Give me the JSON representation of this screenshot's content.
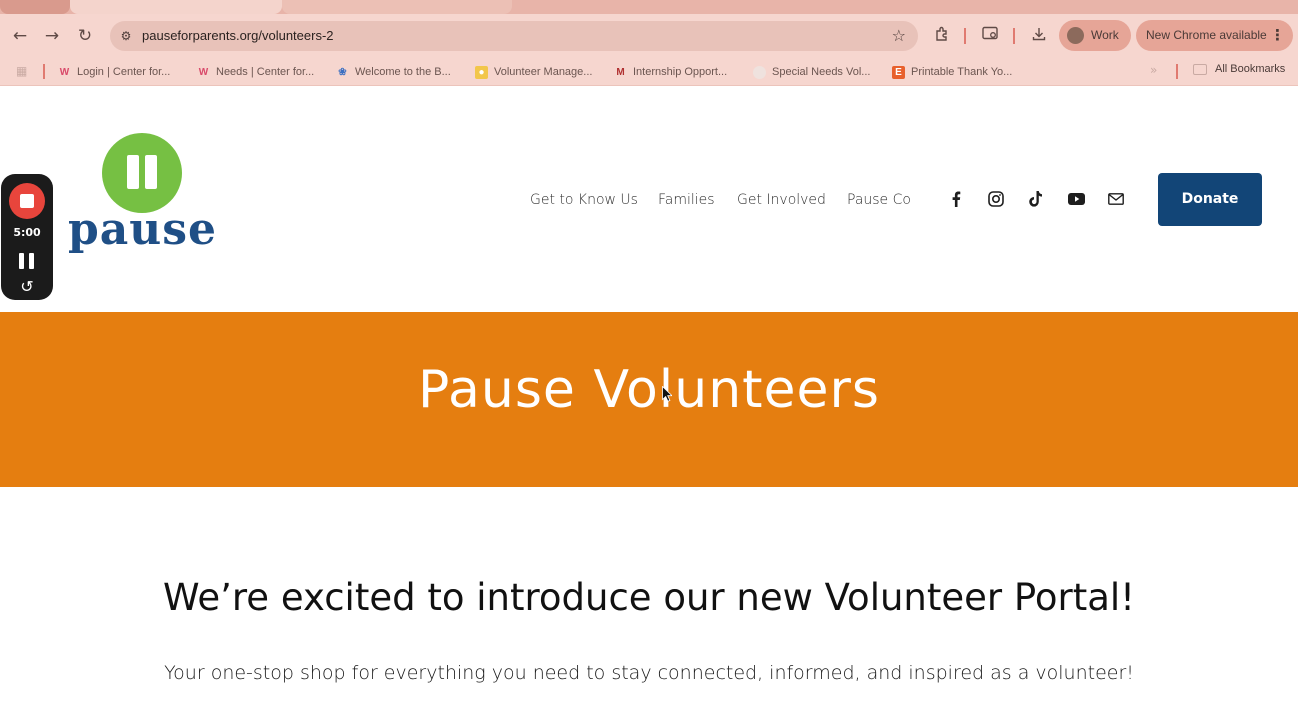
{
  "browser": {
    "url": "pauseforparents.org/volunteers-2",
    "profile_label": "Work",
    "update_label": "New Chrome available",
    "bookmarks": [
      {
        "label": "Login | Center for...",
        "icon": "center-for-logo-icon",
        "color": "#d94a6a"
      },
      {
        "label": "Needs | Center for...",
        "icon": "center-for-logo-icon",
        "color": "#d94a6a"
      },
      {
        "label": "Welcome to the B...",
        "icon": "butterfly-icon",
        "color": "#3b6fc2"
      },
      {
        "label": "Volunteer Manage...",
        "icon": "volunteer-manager-icon",
        "color": "#e0a030"
      },
      {
        "label": "Internship Opport...",
        "icon": "m-logo-icon",
        "color": "#b03030"
      },
      {
        "label": "Special Needs Vol...",
        "icon": "special-needs-icon",
        "color": "#e8d8d4"
      },
      {
        "label": "Printable Thank Yo...",
        "icon": "etsy-icon",
        "color": "#e8602c"
      }
    ],
    "all_bookmarks_label": "All Bookmarks"
  },
  "site": {
    "logo_text": "pause",
    "nav": [
      "Get to Know Us",
      "Families",
      "Get Involved",
      "Pause Co"
    ],
    "social_icons": [
      "facebook-icon",
      "instagram-icon",
      "tiktok-icon",
      "youtube-icon",
      "email-icon"
    ],
    "donate_label": "Donate",
    "colors": {
      "brand_orange": "#e57e10",
      "brand_navy": "#124577",
      "logo_green": "#76c043"
    }
  },
  "recorder": {
    "time": "5:00"
  },
  "hero": {
    "title": "Pause Volunteers"
  },
  "intro": {
    "heading": "We’re excited to introduce our new Volunteer Portal!",
    "text": "Your one-stop shop for everything you need to stay connected, informed, and inspired as a volunteer!"
  }
}
